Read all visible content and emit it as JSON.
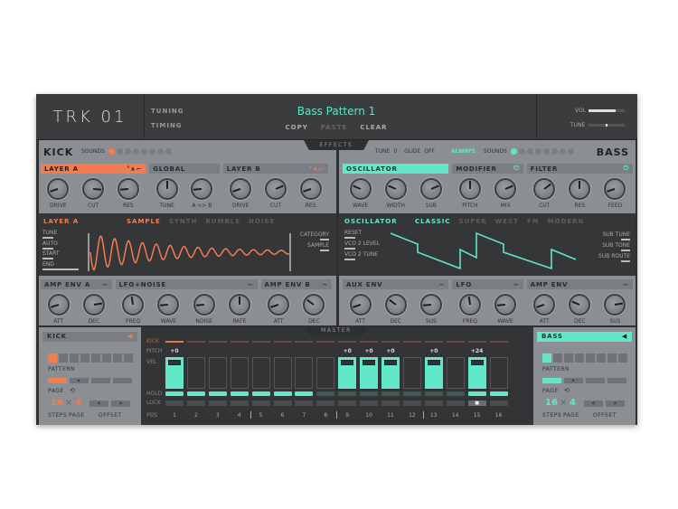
{
  "header": {
    "logo": "TRK 01",
    "links": [
      "TUNING",
      "TIMING"
    ],
    "pattern_title": "Bass Pattern 1",
    "actions": [
      "COPY",
      "PASTE",
      "CLEAR"
    ],
    "vol_label": "VOL",
    "vol": 0.75,
    "tune_label": "TUNE",
    "tune": 0.5
  },
  "tabs": {
    "effects": "EFFECTS",
    "master": "MASTER"
  },
  "colors": {
    "kick": "#f47c4f",
    "bass": "#62e8c8"
  },
  "kick": {
    "name": "KICK",
    "sounds_label": "SOUNDS",
    "sounds_count": 8,
    "sound_active": 0,
    "top": [
      {
        "label": "LAYER A",
        "style": "orange",
        "icon": "shape-selector-icon",
        "knobs": [
          {
            "label": "DRIVE",
            "value": 0.1
          },
          {
            "label": "CUT",
            "value": 0.85
          },
          {
            "label": "RES",
            "value": 0.15
          }
        ]
      },
      {
        "label": "GLOBAL",
        "knobs": [
          {
            "label": "TUNE",
            "value": 0.5
          },
          {
            "label": "A <> B",
            "value": 0.15
          }
        ]
      },
      {
        "label": "LAYER B",
        "icon": "shape-selector-icon",
        "knobs": [
          {
            "label": "DRIVE",
            "value": 0.1
          },
          {
            "label": "CUT",
            "value": 0.75
          },
          {
            "label": "RES",
            "value": 0.1
          }
        ]
      }
    ],
    "display": {
      "title": "LAYER A",
      "tabs": [
        "SAMPLE",
        "SYNTH",
        "RUMBLE",
        "NOISE"
      ],
      "active_tab": 0,
      "left": [
        "TUNE",
        "AUTO",
        "START",
        "END"
      ],
      "right": [
        "CATEGORY",
        "SAMPLE"
      ]
    },
    "bottom": [
      {
        "label": "AMP ENV A",
        "icon": "envelope-icon",
        "knobs": [
          {
            "label": "ATT",
            "value": 0.1
          },
          {
            "label": "DEC",
            "value": 0.8
          }
        ]
      },
      {
        "label": "LFO+NOISE",
        "icon": "envelope-icon",
        "knobs": [
          {
            "label": "FREQ",
            "value": 0.47
          },
          {
            "label": "WAVE",
            "value": 0.15
          },
          {
            "label": "NOISE",
            "value": 0.15
          },
          {
            "label": "RATE",
            "value": 0.5
          }
        ]
      },
      {
        "label": "AMP ENV B",
        "icon": "envelope-icon",
        "knobs": [
          {
            "label": "ATT",
            "value": 0.1
          },
          {
            "label": "DEC",
            "value": 0.3
          }
        ]
      }
    ]
  },
  "bass": {
    "name": "BASS",
    "tune_label": "TUNE",
    "tune": "0",
    "glide_label": "GLIDE",
    "glide": "OFF",
    "always": "ALWAYS",
    "sounds_label": "SOUNDS",
    "sounds_count": 8,
    "sound_active": 0,
    "top": [
      {
        "label": "OSCILLATOR",
        "style": "teal",
        "knobs": [
          {
            "label": "WAVE",
            "value": 0.25
          },
          {
            "label": "WIDTH",
            "value": 0.25
          },
          {
            "label": "SUB",
            "value": 0.75
          }
        ]
      },
      {
        "label": "MODIFIER",
        "icon": "power-icon",
        "knobs": [
          {
            "label": "PITCH",
            "value": 0.5
          },
          {
            "label": "MIX",
            "value": 0.75
          }
        ]
      },
      {
        "label": "FILTER",
        "icon": "power-icon",
        "knobs": [
          {
            "label": "CUT",
            "value": 0.7
          },
          {
            "label": "RES",
            "value": 0.5
          },
          {
            "label": "FEED",
            "value": 0.1
          }
        ]
      }
    ],
    "display": {
      "title": "OSCILLATOR",
      "tabs": [
        "CLASSIC",
        "SUPER",
        "WEST",
        "FM",
        "MODERN"
      ],
      "active_tab": 0,
      "left": [
        "RESET",
        "VCO 2 LEVEL",
        "VCO 2 TUNE"
      ],
      "right": [
        "SUB TUNE",
        "SUB TONE",
        "SUB ROUTE"
      ]
    },
    "bottom": [
      {
        "label": "AUX ENV",
        "icon": "envelope-icon",
        "knobs": [
          {
            "label": "ATT",
            "value": 0.1
          },
          {
            "label": "DEC",
            "value": 0.3
          },
          {
            "label": "SUS",
            "value": 0.15
          }
        ]
      },
      {
        "label": "LFO",
        "icon": "envelope-icon",
        "knobs": [
          {
            "label": "FREQ",
            "value": 0.47
          },
          {
            "label": "WAVE",
            "value": 0.15
          }
        ]
      },
      {
        "label": "AMP ENV",
        "icon": "envelope-icon",
        "knobs": [
          {
            "label": "ATT",
            "value": 0.1
          },
          {
            "label": "DEC",
            "value": 0.25
          },
          {
            "label": "SUS",
            "value": 0.8
          }
        ]
      }
    ]
  },
  "seq": {
    "row_labels": [
      "KICK",
      "PITCH",
      "VEL",
      "HOLD",
      "LOCK",
      "POS"
    ],
    "steps": [
      {
        "pos": "1",
        "pitch": "+0",
        "vel": 1,
        "hold": true,
        "lock": false
      },
      {
        "pos": "2",
        "pitch": "",
        "vel": 0,
        "hold": true,
        "lock": false
      },
      {
        "pos": "3",
        "pitch": "",
        "vel": 0,
        "hold": true,
        "lock": false
      },
      {
        "pos": "4",
        "pitch": "",
        "vel": 0,
        "hold": true,
        "lock": false
      },
      {
        "pos": "5",
        "pitch": "",
        "vel": 0,
        "hold": true,
        "lock": false
      },
      {
        "pos": "6",
        "pitch": "",
        "vel": 0,
        "hold": true,
        "lock": false
      },
      {
        "pos": "7",
        "pitch": "",
        "vel": 0,
        "hold": true,
        "lock": false
      },
      {
        "pos": "8",
        "pitch": "",
        "vel": 0,
        "hold": false,
        "lock": false
      },
      {
        "pos": "9",
        "pitch": "+0",
        "vel": 1,
        "hold": false,
        "lock": false
      },
      {
        "pos": "10",
        "pitch": "+0",
        "vel": 1,
        "hold": false,
        "lock": false
      },
      {
        "pos": "11",
        "pitch": "+0",
        "vel": 1,
        "hold": false,
        "lock": false
      },
      {
        "pos": "12",
        "pitch": "",
        "vel": 0,
        "hold": false,
        "lock": false
      },
      {
        "pos": "13",
        "pitch": "+0",
        "vel": 1,
        "hold": false,
        "lock": false
      },
      {
        "pos": "14",
        "pitch": "",
        "vel": 0,
        "hold": false,
        "lock": false
      },
      {
        "pos": "15",
        "pitch": "+24",
        "vel": 1,
        "hold": true,
        "lock": true
      },
      {
        "pos": "16",
        "pitch": "",
        "vel": 0,
        "hold": true,
        "lock": false
      }
    ],
    "left": {
      "name": "KICK",
      "pattern_label": "PATTERN",
      "page_label": "PAGE",
      "steps": "16",
      "pages": "4",
      "times": "×",
      "steps_label": "STEPS",
      "pages_label": "PAGE",
      "offset_label": "OFFSET",
      "prev": "«",
      "next": "»",
      "play": "▸"
    },
    "right": {
      "name": "BASS",
      "pattern_label": "PATTERN",
      "page_label": "PAGE",
      "steps": "16",
      "pages": "4",
      "times": "×",
      "steps_label": "STEPS",
      "pages_label": "PAGE",
      "offset_label": "OFFSET",
      "prev": "«",
      "next": "»",
      "play": "▸"
    }
  }
}
